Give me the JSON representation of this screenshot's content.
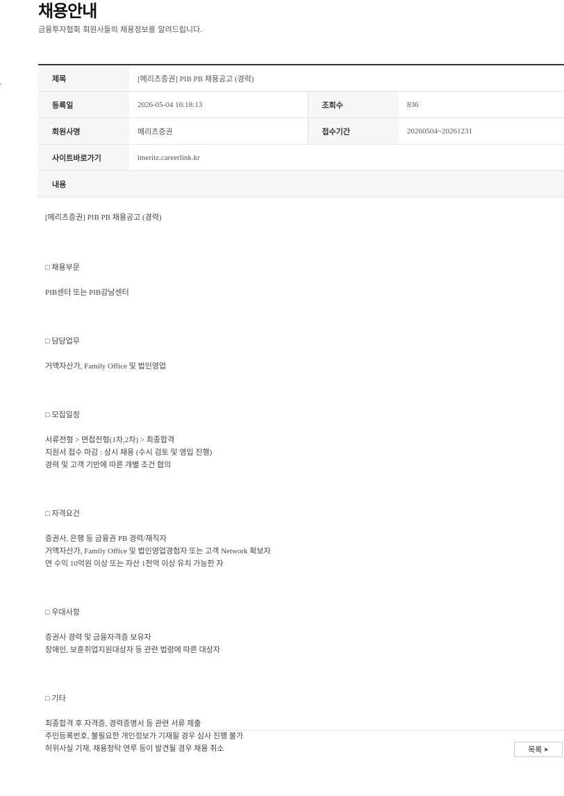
{
  "page": {
    "title": "채용안내",
    "subtitle": "금융투자협회 회원사들의 채용정보를 알려드립니다."
  },
  "info": {
    "title_label": "제목",
    "title_value": "[메리츠증권] PIB PB 채용공고 (경력)",
    "date_label": "등록일",
    "date_value": "2026-05-04 16:18:13",
    "views_label": "조회수",
    "views_value": "836",
    "company_label": "회원사명",
    "company_value": "메리츠증권",
    "period_label": "접수기간",
    "period_value": "20260504~20261231",
    "site_label": "사이트바로가기",
    "site_value": "imeritz.careerlink.kr",
    "content_label": "내용"
  },
  "content": {
    "intro": "[메리츠증권] PIB PB 채용공고 (경력)",
    "sections": [
      {
        "heading": "□ 채용부문",
        "lines": [
          "PIB센터 또는 PIB강남센터"
        ]
      },
      {
        "heading": "□ 담당업무",
        "lines": [
          "거액자산가, Family Office 및 법인영업"
        ]
      },
      {
        "heading": "□ 모집일정",
        "lines": [
          "서류전형 > 면접전형(1차,2차) > 최종합격",
          "지원서 접수 마감 : 상시 채용 (수시 검토 및 영입 진행)",
          "경력 및 고객 기반에 따른 개별 조건 협의"
        ]
      },
      {
        "heading": "□ 자격요건",
        "lines": [
          "증권사, 은행 등 금융권 PB 경력/재직자",
          "거액자산가, Family Office 및 법인영업경험자 또는 고객 Network 확보자",
          "연 수익 10억원 이상 또는 자산 1천억 이상 유치 가능한 자"
        ]
      },
      {
        "heading": "□ 우대사항",
        "lines": [
          "증권사 경력 및 금융자격증 보유자",
          "장애인, 보훈취업지원대상자 등 관련 법령에 따른 대상자"
        ]
      },
      {
        "heading": "□ 기타",
        "lines": [
          "최종합격 후 자격증, 경력증명서 등 관련 서류 제출",
          "주민등록번호, 불필요한 개인정보가 기재될 경우 심사 진행 불가",
          "허위사실 기재, 채용청탁 연루 등이 발견될 경우 채용 취소"
        ]
      }
    ]
  },
  "buttons": {
    "list_label": "목록",
    "list_icon": "triangle-right-icon"
  }
}
